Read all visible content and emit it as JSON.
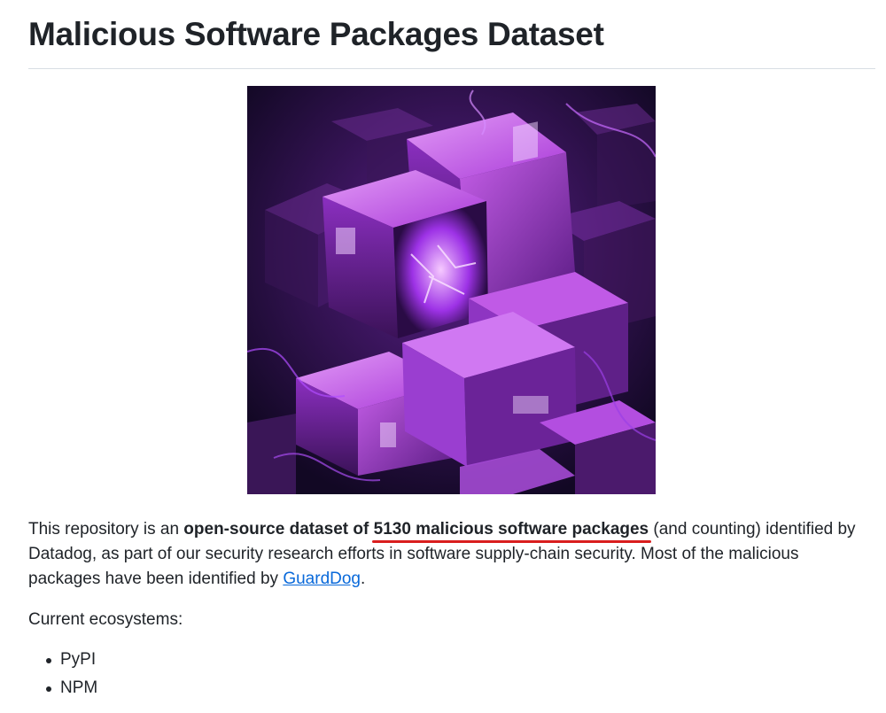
{
  "page": {
    "title": "Malicious Software Packages Dataset"
  },
  "hero_image": {
    "icon": "malicious-packages-illustration",
    "colors": {
      "background": "#160a2c",
      "box_light": "#c64df0",
      "box_dark": "#3a1657",
      "glow": "#b14dff"
    }
  },
  "intro": {
    "text_1": "This repository is an ",
    "bold_1": "open-source dataset of ",
    "bold_highlight": "5130 malicious software packages",
    "text_2": " (and counting) identified by Datadog, as part of our security research efforts in software supply-chain security. Most of the malicious packages have been identified by ",
    "link_text": "GuardDog",
    "text_3": "."
  },
  "ecosystems": {
    "label": "Current ecosystems:",
    "items": [
      "PyPI",
      "NPM"
    ]
  },
  "colors": {
    "text": "#1f2328",
    "link": "#0969da",
    "highlight_underline": "#d91e1e",
    "rule": "#d8dee4"
  }
}
